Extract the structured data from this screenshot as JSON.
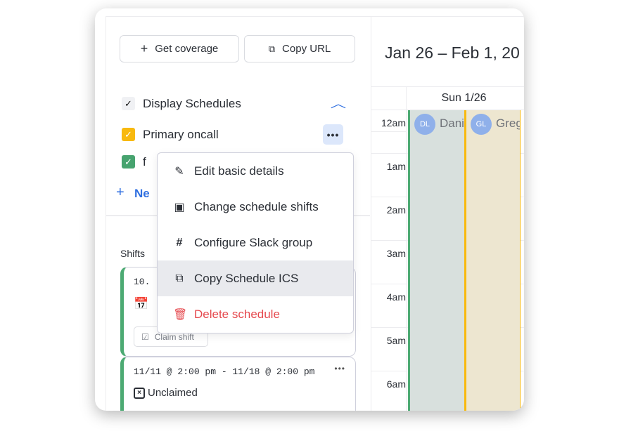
{
  "toolbar": {
    "get_coverage": "Get coverage",
    "copy_url": "Copy URL"
  },
  "schedules": {
    "header": "Display Schedules",
    "items": [
      {
        "label": "Primary oncall",
        "color": "#f8b90f"
      },
      {
        "label": "f",
        "color": "#47a36f"
      }
    ],
    "new_label": "Ne"
  },
  "menu": {
    "items": [
      {
        "label": "Edit basic details",
        "icon": "pencil-icon"
      },
      {
        "label": "Change schedule shifts",
        "icon": "calendar-icon"
      },
      {
        "label": "Configure Slack group",
        "icon": "slack-icon"
      },
      {
        "label": "Copy Schedule ICS",
        "icon": "copy-icon"
      },
      {
        "label": "Delete schedule",
        "icon": "trash-icon"
      }
    ]
  },
  "shifts": {
    "title": "Shifts",
    "items": [
      {
        "time": "10.",
        "status": "",
        "claim": "Claim shift"
      },
      {
        "time": "11/11 @ 2:00 pm - 11/18 @ 2:00 pm",
        "status": "Unclaimed",
        "claim": ""
      }
    ]
  },
  "calendar": {
    "range": "Jan 26 – Feb 1, 20",
    "day": "Sun 1/26",
    "hours": [
      "12am",
      "1am",
      "2am",
      "3am",
      "4am",
      "5am",
      "6am"
    ],
    "events": [
      {
        "initials": "DL",
        "name": "Dani",
        "bg": "#d8e0dd",
        "border": "#4caa73"
      },
      {
        "initials": "GL",
        "name": "Greg",
        "bg": "#ede6d0",
        "border": "#f8b90f"
      }
    ]
  }
}
